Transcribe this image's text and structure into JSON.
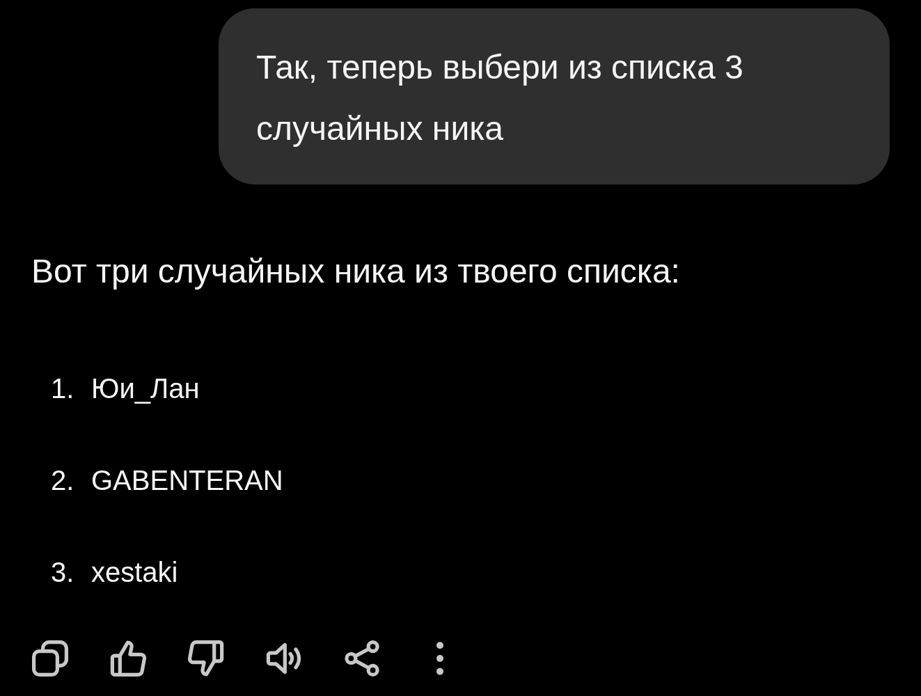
{
  "conversation": {
    "user_message": {
      "text": "Так, теперь выбери из списка 3 случайных ника"
    },
    "assistant_message": {
      "intro": "Вот три случайных ника из твоего списка:",
      "list": [
        {
          "number": "1.",
          "name": "Юи_Лан"
        },
        {
          "number": "2.",
          "name": "GABENTERAN"
        },
        {
          "number": "3.",
          "name": "xestaki"
        }
      ],
      "actions": [
        {
          "kind": "copy"
        },
        {
          "kind": "like"
        },
        {
          "kind": "dislike"
        },
        {
          "kind": "speak"
        },
        {
          "kind": "share"
        },
        {
          "kind": "more"
        }
      ]
    }
  }
}
